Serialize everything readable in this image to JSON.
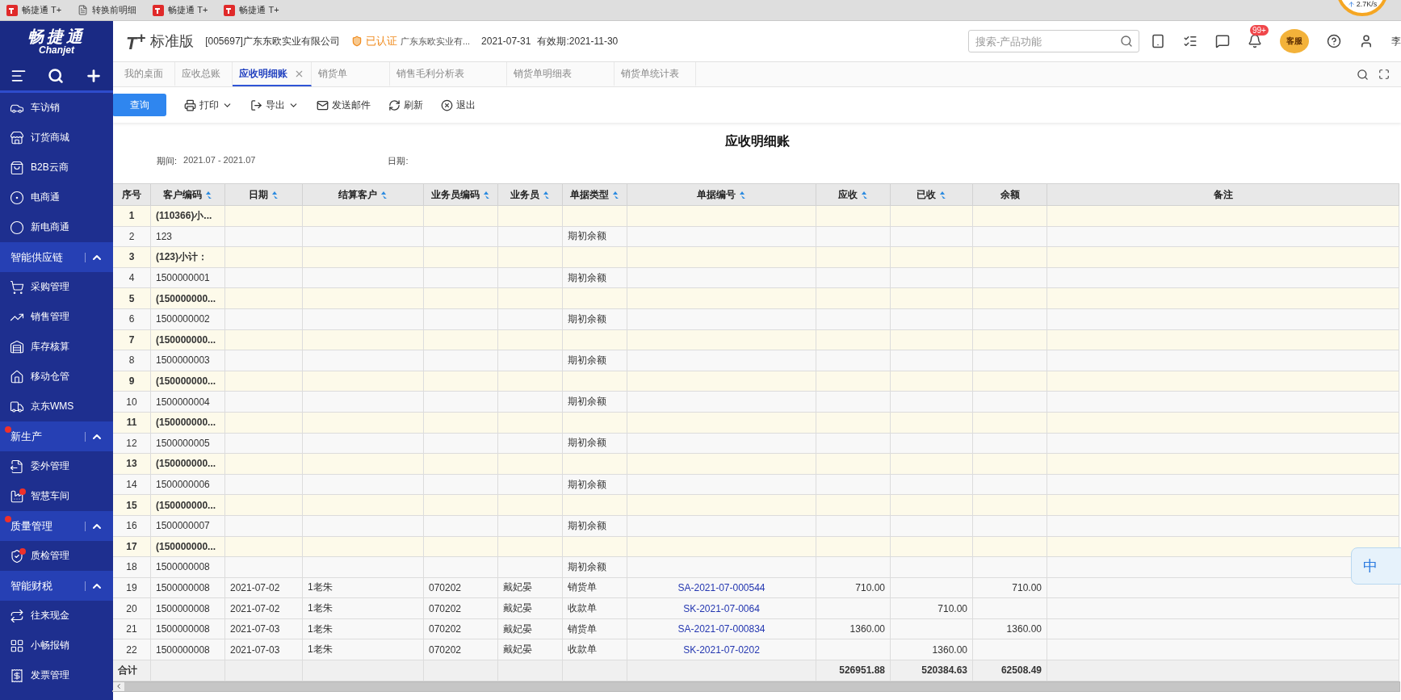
{
  "browser_tabs": [
    {
      "title": "畅捷通 T+",
      "kind": "app"
    },
    {
      "title": "转换前明细",
      "kind": "doc"
    },
    {
      "title": "畅捷通 T+",
      "kind": "app"
    },
    {
      "title": "畅捷通 T+",
      "kind": "app"
    }
  ],
  "speed_meter": {
    "reading": "2.7K/s"
  },
  "sidebar": {
    "logo": "畅捷通",
    "logo_sub": "Chanjet",
    "items": [
      {
        "kind": "item",
        "label": "车访销",
        "dot": false
      },
      {
        "kind": "item",
        "label": "订货商城",
        "dot": false
      },
      {
        "kind": "item",
        "label": "B2B云商",
        "dot": false
      },
      {
        "kind": "item",
        "label": "电商通",
        "dot": false
      },
      {
        "kind": "item",
        "label": "新电商通",
        "dot": false
      },
      {
        "kind": "section",
        "label": "智能供应链",
        "dot": false,
        "expanded": true
      },
      {
        "kind": "item",
        "label": "采购管理",
        "dot": false
      },
      {
        "kind": "item",
        "label": "销售管理",
        "dot": false
      },
      {
        "kind": "item",
        "label": "库存核算",
        "dot": false
      },
      {
        "kind": "item",
        "label": "移动仓管",
        "dot": false
      },
      {
        "kind": "item",
        "label": "京东WMS",
        "dot": false
      },
      {
        "kind": "section",
        "label": "新生产",
        "dot": true,
        "expanded": true
      },
      {
        "kind": "item",
        "label": "委外管理",
        "dot": false
      },
      {
        "kind": "item",
        "label": "智慧车间",
        "dot": true
      },
      {
        "kind": "section",
        "label": "质量管理",
        "dot": true,
        "expanded": true
      },
      {
        "kind": "item",
        "label": "质检管理",
        "dot": true
      },
      {
        "kind": "section",
        "label": "智能财税",
        "dot": false,
        "expanded": true
      },
      {
        "kind": "item",
        "label": "往来现金",
        "dot": false
      },
      {
        "kind": "item",
        "label": "小畅报销",
        "dot": false
      },
      {
        "kind": "item",
        "label": "发票管理",
        "dot": false
      }
    ]
  },
  "app_header": {
    "product": "T$^{+}$",
    "edition": "标准版",
    "company": "[005697]广东东欧实业有限公司",
    "certified": "已认证",
    "certified_company": "广东东欧实业有...",
    "date": "2021-07-31",
    "valid": "有效期:2021-11-30",
    "search_placeholder": "搜索-产品功能",
    "notification_badge": "99+",
    "service_label": "客服",
    "user": "李"
  },
  "tabs": [
    {
      "label": "我的桌面",
      "selected": false
    },
    {
      "label": "应收总账",
      "selected": false
    },
    {
      "label": "应收明细账",
      "selected": true
    },
    {
      "label": "销货单",
      "selected": false
    },
    {
      "label": "销售毛利分析表",
      "selected": false
    },
    {
      "label": "销货单明细表",
      "selected": false
    },
    {
      "label": "销货单统计表",
      "selected": false
    }
  ],
  "toolbar": {
    "query": "查询",
    "actions": [
      {
        "label": "打印",
        "dropdown": true
      },
      {
        "label": "导出",
        "dropdown": true
      },
      {
        "label": "发送邮件",
        "dropdown": false
      },
      {
        "label": "刷新",
        "dropdown": false
      },
      {
        "label": "退出",
        "dropdown": false
      }
    ]
  },
  "report": {
    "title": "应收明细账",
    "period_label": "期间:",
    "period": "2021.07 - 2021.07",
    "date_label": "日期:"
  },
  "table": {
    "columns": [
      {
        "label": "序号",
        "sortable": false
      },
      {
        "label": "客户编码",
        "sortable": true
      },
      {
        "label": "日期",
        "sortable": true
      },
      {
        "label": "结算客户",
        "sortable": true
      },
      {
        "label": "业务员编码",
        "sortable": true
      },
      {
        "label": "业务员",
        "sortable": true
      },
      {
        "label": "单据类型",
        "sortable": true
      },
      {
        "label": "单据编号",
        "sortable": true
      },
      {
        "label": "应收",
        "sortable": true
      },
      {
        "label": "已收",
        "sortable": true
      },
      {
        "label": "余额",
        "sortable": false
      },
      {
        "label": "备注",
        "sortable": false
      }
    ],
    "rows": [
      {
        "kind": "subtotal",
        "cells": [
          "1",
          "(110366)小...",
          null,
          null,
          null,
          null,
          null,
          null,
          null,
          null,
          null,
          null
        ]
      },
      {
        "kind": "detail",
        "cells": [
          "2",
          "123",
          null,
          null,
          null,
          null,
          "期初余额",
          null,
          null,
          null,
          null,
          null
        ]
      },
      {
        "kind": "subtotal",
        "cells": [
          "3",
          "(123)小计：",
          null,
          null,
          null,
          null,
          null,
          null,
          null,
          null,
          null,
          null
        ]
      },
      {
        "kind": "detail",
        "cells": [
          "4",
          "1500000001",
          null,
          null,
          null,
          null,
          "期初余额",
          null,
          null,
          null,
          null,
          null
        ]
      },
      {
        "kind": "subtotal",
        "cells": [
          "5",
          "(150000000...",
          null,
          null,
          null,
          null,
          null,
          null,
          null,
          null,
          null,
          null
        ]
      },
      {
        "kind": "detail",
        "cells": [
          "6",
          "1500000002",
          null,
          null,
          null,
          null,
          "期初余额",
          null,
          null,
          null,
          null,
          null
        ]
      },
      {
        "kind": "subtotal",
        "cells": [
          "7",
          "(150000000...",
          null,
          null,
          null,
          null,
          null,
          null,
          null,
          null,
          null,
          null
        ]
      },
      {
        "kind": "detail",
        "cells": [
          "8",
          "1500000003",
          null,
          null,
          null,
          null,
          "期初余额",
          null,
          null,
          null,
          null,
          null
        ]
      },
      {
        "kind": "subtotal",
        "cells": [
          "9",
          "(150000000...",
          null,
          null,
          null,
          null,
          null,
          null,
          null,
          null,
          null,
          null
        ]
      },
      {
        "kind": "detail",
        "cells": [
          "10",
          "1500000004",
          null,
          null,
          null,
          null,
          "期初余额",
          null,
          null,
          null,
          null,
          null
        ]
      },
      {
        "kind": "subtotal",
        "cells": [
          "11",
          "(150000000...",
          null,
          null,
          null,
          null,
          null,
          null,
          null,
          null,
          null,
          null
        ]
      },
      {
        "kind": "detail",
        "cells": [
          "12",
          "1500000005",
          null,
          null,
          null,
          null,
          "期初余额",
          null,
          null,
          null,
          null,
          null
        ]
      },
      {
        "kind": "subtotal",
        "cells": [
          "13",
          "(150000000...",
          null,
          null,
          null,
          null,
          null,
          null,
          null,
          null,
          null,
          null
        ]
      },
      {
        "kind": "detail",
        "cells": [
          "14",
          "1500000006",
          null,
          null,
          null,
          null,
          "期初余额",
          null,
          null,
          null,
          null,
          null
        ]
      },
      {
        "kind": "subtotal",
        "cells": [
          "15",
          "(150000000...",
          null,
          null,
          null,
          null,
          null,
          null,
          null,
          null,
          null,
          null
        ]
      },
      {
        "kind": "detail",
        "cells": [
          "16",
          "1500000007",
          null,
          null,
          null,
          null,
          "期初余额",
          null,
          null,
          null,
          null,
          null
        ]
      },
      {
        "kind": "subtotal",
        "cells": [
          "17",
          "(150000000...",
          null,
          null,
          null,
          null,
          null,
          null,
          null,
          null,
          null,
          null
        ]
      },
      {
        "kind": "detail",
        "cells": [
          "18",
          "1500000008",
          null,
          null,
          null,
          null,
          "期初余额",
          null,
          null,
          null,
          null,
          null
        ]
      },
      {
        "kind": "detail",
        "cells": [
          "19",
          "1500000008",
          "2021-07-02",
          "1老朱",
          "070202",
          "戴妃晏",
          "销货单",
          "SA-2021-07-000544",
          "710.00",
          null,
          "710.00",
          null
        ]
      },
      {
        "kind": "detail",
        "cells": [
          "20",
          "1500000008",
          "2021-07-02",
          "1老朱",
          "070202",
          "戴妃晏",
          "收款单",
          "SK-2021-07-0064",
          null,
          "710.00",
          null,
          null
        ]
      },
      {
        "kind": "detail",
        "cells": [
          "21",
          "1500000008",
          "2021-07-03",
          "1老朱",
          "070202",
          "戴妃晏",
          "销货单",
          "SA-2021-07-000834",
          "1360.00",
          null,
          "1360.00",
          null
        ]
      },
      {
        "kind": "detail",
        "cells": [
          "22",
          "1500000008",
          "2021-07-03",
          "1老朱",
          "070202",
          "戴妃晏",
          "收款单",
          "SK-2021-07-0202",
          null,
          "1360.00",
          null,
          null
        ]
      }
    ],
    "total": {
      "cells": [
        "合计",
        null,
        null,
        null,
        null,
        null,
        null,
        null,
        "526951.88",
        "520384.63",
        "62508.49",
        null
      ]
    }
  },
  "ime_widget": {
    "label": "中"
  }
}
